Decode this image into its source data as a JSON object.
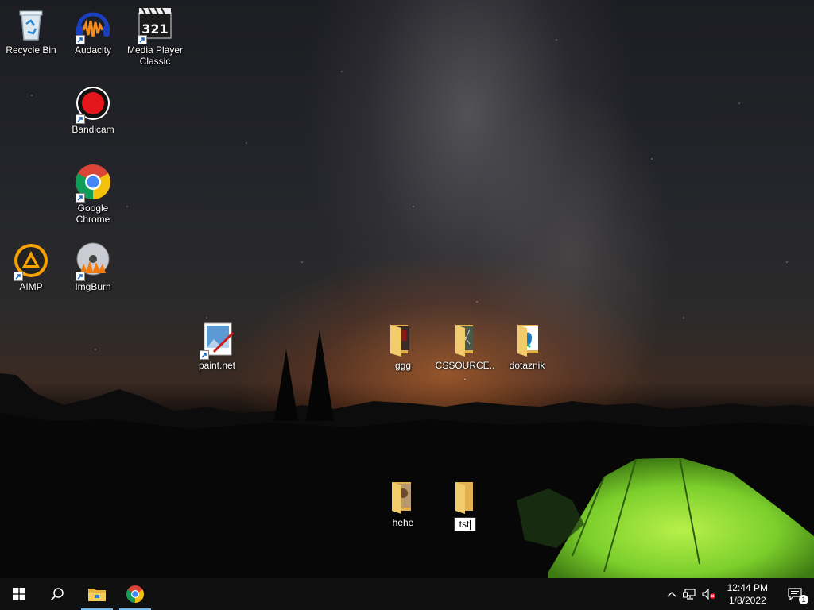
{
  "desktop": {
    "icons": [
      {
        "id": "recycle-bin",
        "label": "Recycle Bin",
        "icon": "recycle-bin-icon"
      },
      {
        "id": "audacity",
        "label": "Audacity",
        "icon": "audacity-icon"
      },
      {
        "id": "media-player-classic",
        "label": "Media Player Classic",
        "icon": "media-player-classic-icon"
      },
      {
        "id": "bandicam",
        "label": "Bandicam",
        "icon": "bandicam-icon"
      },
      {
        "id": "google-chrome",
        "label": "Google Chrome",
        "icon": "chrome-icon"
      },
      {
        "id": "aimp",
        "label": "AIMP",
        "icon": "aimp-icon"
      },
      {
        "id": "imgburn",
        "label": "ImgBurn",
        "icon": "imgburn-icon"
      },
      {
        "id": "paint-net",
        "label": "paint.net",
        "icon": "paint-net-icon"
      },
      {
        "id": "ggg",
        "label": "ggg",
        "icon": "folder-icon"
      },
      {
        "id": "cssource",
        "label": "CSSOURCE...",
        "icon": "folder-icon"
      },
      {
        "id": "dotaznik",
        "label": "dotaznik",
        "icon": "folder-icon"
      },
      {
        "id": "hehe",
        "label": "hehe",
        "icon": "folder-icon"
      },
      {
        "id": "tst",
        "label": "tst",
        "icon": "folder-icon",
        "renaming": true
      }
    ]
  },
  "taskbar": {
    "start": {
      "icon": "windows-start-icon"
    },
    "search": {
      "icon": "search-icon"
    },
    "pinned": [
      {
        "name": "File Explorer",
        "icon": "file-explorer-icon",
        "active": true
      },
      {
        "name": "Google Chrome",
        "icon": "chrome-icon",
        "active": true
      }
    ],
    "tray": {
      "chevron": "chevron-up-icon",
      "network": "network-icon",
      "volume": "volume-muted-icon",
      "time": "12:44 PM",
      "date": "1/8/2022",
      "notifications_count": "1"
    }
  },
  "colors": {
    "taskbar_bg": "#101010",
    "active_indicator": "#76b9ed",
    "folder_yellow": "#f2cc6b",
    "tent_green": "#8fe03a"
  }
}
